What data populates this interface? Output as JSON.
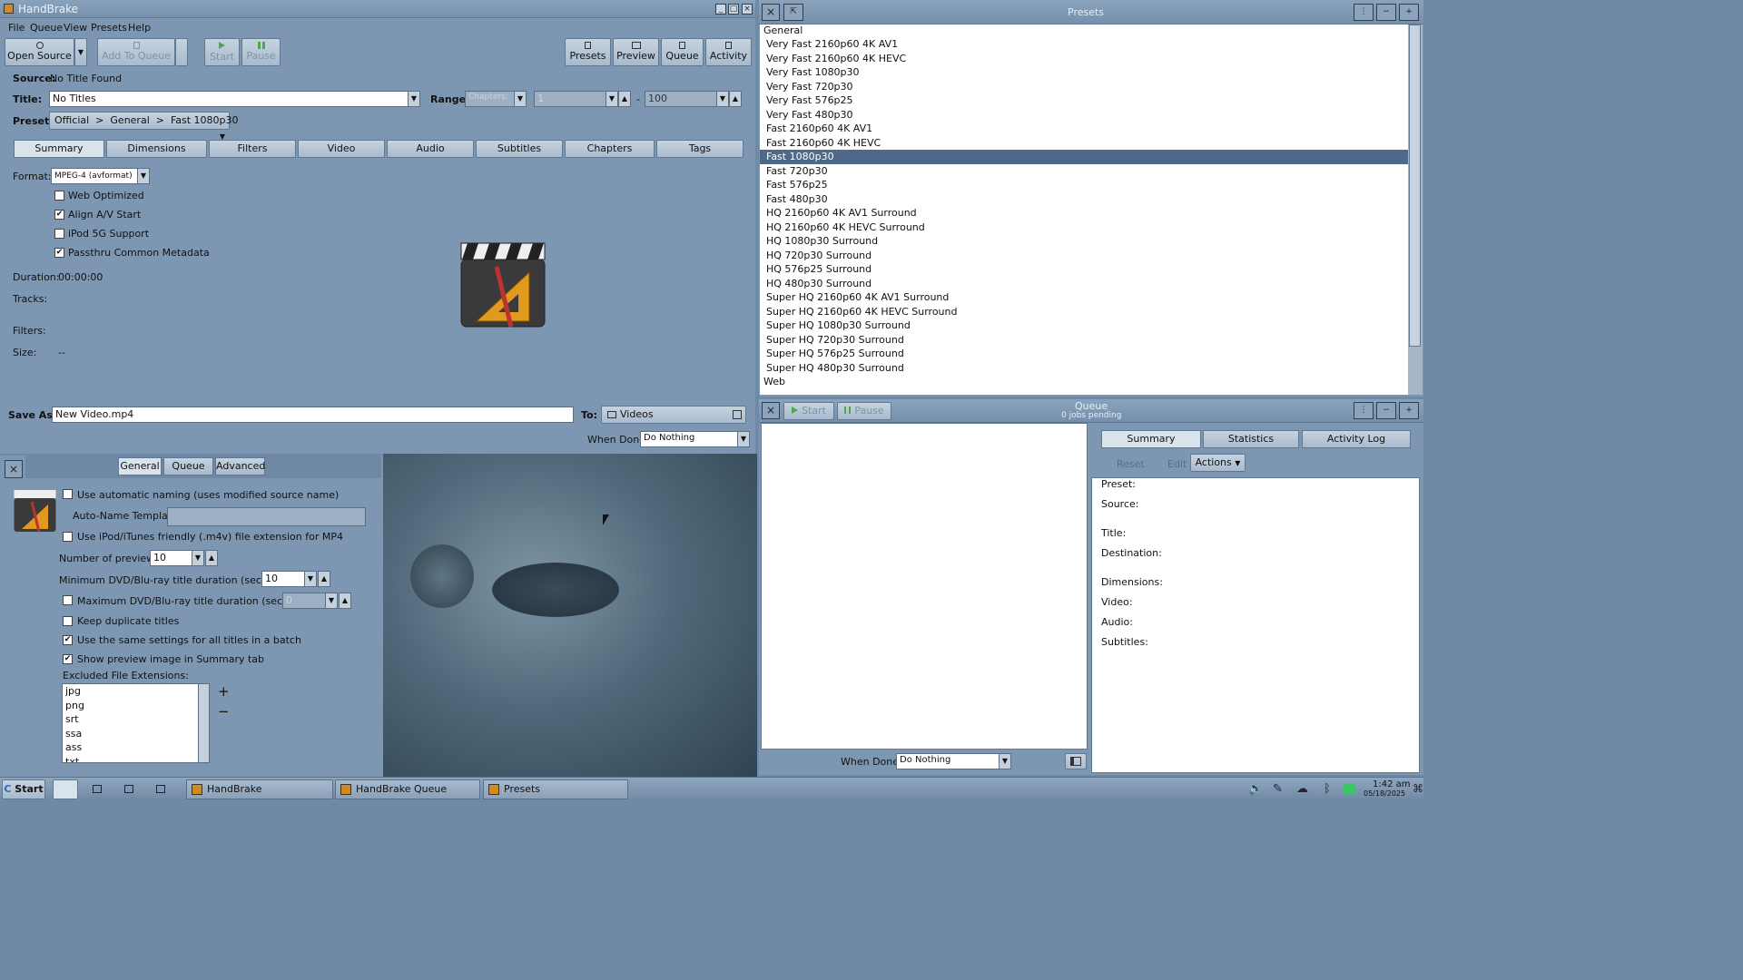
{
  "main": {
    "title": "HandBrake",
    "menu": [
      "File",
      "Queue",
      "View",
      "Presets",
      "Help"
    ],
    "toolbar": {
      "open_source": "Open Source",
      "add_to_queue": "Add To Queue",
      "start": "Start",
      "pause": "Pause",
      "presets": "Presets",
      "preview": "Preview",
      "queue": "Queue",
      "activity": "Activity"
    },
    "source_label": "Source:",
    "source_value": "No Title Found",
    "title_label": "Title:",
    "title_value": "No Titles",
    "range_label": "Range:",
    "range_mode": "Chapters:",
    "range_start": "1",
    "range_sep": "-",
    "range_end": "100",
    "preset_label": "Preset:",
    "preset_value": "Official  >  General  >  Fast 1080p30",
    "tabs": [
      "Summary",
      "Dimensions",
      "Filters",
      "Video",
      "Audio",
      "Subtitles",
      "Chapters",
      "Tags"
    ],
    "format_label": "Format:",
    "format_value": "MPEG-4 (avformat)",
    "options": [
      {
        "label": "Web Optimized",
        "checked": false
      },
      {
        "label": "Align A/V Start",
        "checked": true
      },
      {
        "label": "iPod 5G Support",
        "checked": false
      },
      {
        "label": "Passthru Common Metadata",
        "checked": true
      }
    ],
    "duration_label": "Duration:",
    "duration_value": "00:00:00",
    "tracks_label": "Tracks:",
    "filters_label": "Filters:",
    "size_label": "Size:",
    "size_value": "--",
    "save_as_label": "Save As:",
    "save_as_value": "New Video.mp4",
    "to_label": "To:",
    "to_value": "Videos",
    "when_done_label": "When Done:",
    "when_done_value": "Do Nothing"
  },
  "prefs": {
    "tabs": [
      "General",
      "Queue",
      "Advanced"
    ],
    "auto_naming": "Use automatic naming (uses modified source name)",
    "auto_template_label": "Auto-Name Template",
    "m4v": "Use iPod/iTunes friendly (.m4v) file extension for MP4",
    "num_previews_label": "Number of previews",
    "num_previews_value": "10",
    "min_duration_label": "Minimum DVD/Blu-ray title duration (seconds)",
    "min_duration_value": "10",
    "max_duration_label": "Maximum DVD/Blu-ray title duration (seconds)",
    "max_duration_value": "0",
    "keep_dupes": "Keep duplicate titles",
    "same_settings": "Use the same settings for all titles in a batch",
    "show_preview": "Show preview image in Summary tab",
    "excluded_label": "Excluded File Extensions:",
    "excluded": [
      "jpg",
      "png",
      "srt",
      "ssa",
      "ass",
      "txt"
    ],
    "add_symbol": "+",
    "remove_symbol": "−"
  },
  "presets_panel": {
    "title": "Presets",
    "general_header": "General",
    "items": [
      "Very Fast 2160p60 4K AV1",
      "Very Fast 2160p60 4K HEVC",
      "Very Fast 1080p30",
      "Very Fast 720p30",
      "Very Fast 576p25",
      "Very Fast 480p30",
      "Fast 2160p60 4K AV1",
      "Fast 2160p60 4K HEVC",
      "Fast 1080p30",
      "Fast 720p30",
      "Fast 576p25",
      "Fast 480p30",
      "HQ 2160p60 4K AV1 Surround",
      "HQ 2160p60 4K HEVC Surround",
      "HQ 1080p30 Surround",
      "HQ 720p30 Surround",
      "HQ 576p25 Surround",
      "HQ 480p30 Surround",
      "Super HQ 2160p60 4K AV1 Surround",
      "Super HQ 2160p60 4K HEVC Surround",
      "Super HQ 1080p30 Surround",
      "Super HQ 720p30 Surround",
      "Super HQ 576p25 Surround",
      "Super HQ 480p30 Surround"
    ],
    "selected": "Fast 1080p30",
    "web_header": "Web"
  },
  "queue_panel": {
    "title": "Queue",
    "subtitle": "0 jobs pending",
    "start": "Start",
    "pause": "Pause",
    "tabs": [
      "Summary",
      "Statistics",
      "Activity Log"
    ],
    "reset": "Reset",
    "edit": "Edit",
    "actions": "Actions",
    "fields": [
      "Preset:",
      "Source:",
      "Title:",
      "Destination:",
      "Dimensions:",
      "Video:",
      "Audio:",
      "Subtitles:"
    ],
    "when_done_label": "When Done:",
    "when_done_value": "Do Nothing"
  },
  "taskbar": {
    "start": "Start",
    "tasks": [
      "HandBrake",
      "HandBrake Queue",
      "Presets"
    ],
    "time": "1:42 am",
    "date": "05/18/2025"
  }
}
